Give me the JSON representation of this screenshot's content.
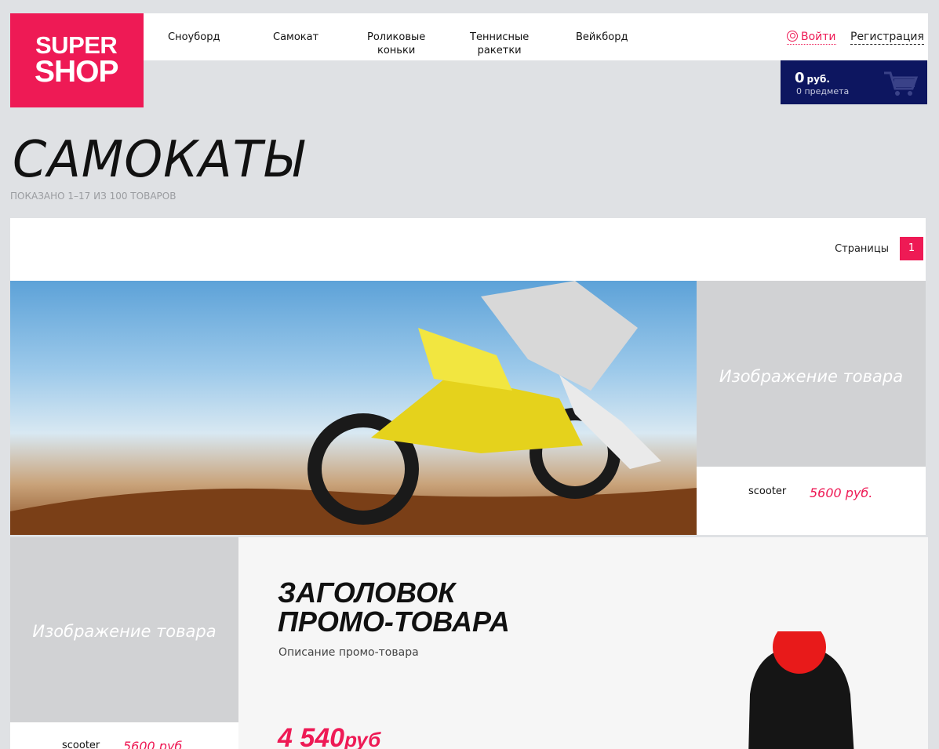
{
  "logo": {
    "line1": "SUPER",
    "line2": "SHOP"
  },
  "nav": [
    {
      "label": "Сноуборд"
    },
    {
      "label": "Самокат"
    },
    {
      "label": "Роликовые\nконьки"
    },
    {
      "label": "Теннисные\nракетки"
    },
    {
      "label": "Вейкборд"
    }
  ],
  "auth": {
    "login": "Войти",
    "register": "Регистрация"
  },
  "cart": {
    "sum": "0",
    "currency": "руб.",
    "count": "0 предмета"
  },
  "page": {
    "title": "САМОКАТЫ",
    "shown": "Показано 1–17 из 100 товаров"
  },
  "pager": {
    "label": "Страницы",
    "current": "1"
  },
  "products": [
    {
      "image_placeholder": "Изображение товара",
      "name": "scooter",
      "price": "5600 руб."
    },
    {
      "image_placeholder": "Изображение товара",
      "name": "scooter",
      "price": "5600 руб."
    }
  ],
  "promo": {
    "title_line1": "Заголовок",
    "title_line2": "промо-товара",
    "description": "Описание промо-товара",
    "price": "4 540",
    "currency": "руб"
  },
  "colors": {
    "accent": "#ee1a55",
    "cart_bg": "#0d1660",
    "page_bg": "#dfe1e4"
  }
}
